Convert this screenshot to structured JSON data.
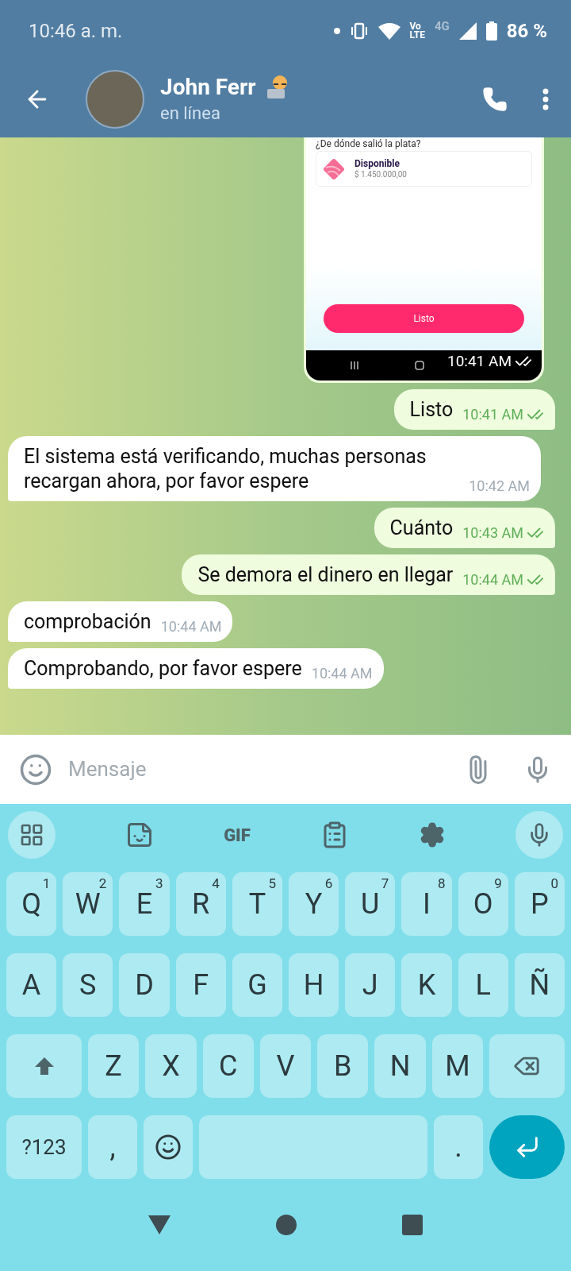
{
  "status_bar": {
    "time": "10:46 a. m.",
    "volte": [
      "Vo",
      "LTE"
    ],
    "network": "4G",
    "battery": "86 %"
  },
  "header": {
    "name": "John Ferr",
    "status": "en línea"
  },
  "messages": [
    {
      "kind": "image",
      "outgoing": true,
      "question": "¿De dónde salió la plata?",
      "item_title": "Disponible",
      "item_amount": "$ 1.450.000,00",
      "button": "Listo",
      "time": "10:41 AM",
      "read": true
    },
    {
      "kind": "text",
      "outgoing": true,
      "text": "Listo",
      "time": "10:41 AM",
      "read": true
    },
    {
      "kind": "text",
      "outgoing": false,
      "text": "El sistema está verificando, muchas personas recargan ahora, por favor espere",
      "time": "10:42 AM"
    },
    {
      "kind": "text",
      "outgoing": true,
      "text": "Cuánto",
      "time": "10:43 AM",
      "read": true
    },
    {
      "kind": "text",
      "outgoing": true,
      "text": "Se demora el dinero en llegar",
      "time": "10:44 AM",
      "read": true
    },
    {
      "kind": "text",
      "outgoing": false,
      "text": "comprobación",
      "time": "10:44 AM"
    },
    {
      "kind": "text",
      "outgoing": false,
      "text": "Comprobando, por favor espere",
      "time": "10:44 AM"
    }
  ],
  "composer": {
    "placeholder": "Mensaje"
  },
  "keyboard": {
    "toolbar_gif": "GIF",
    "rows": [
      [
        {
          "kind": "letter",
          "label": "Q",
          "hint": "1"
        },
        {
          "kind": "letter",
          "label": "W",
          "hint": "2"
        },
        {
          "kind": "letter",
          "label": "E",
          "hint": "3"
        },
        {
          "kind": "letter",
          "label": "R",
          "hint": "4"
        },
        {
          "kind": "letter",
          "label": "T",
          "hint": "5"
        },
        {
          "kind": "letter",
          "label": "Y",
          "hint": "6"
        },
        {
          "kind": "letter",
          "label": "U",
          "hint": "7"
        },
        {
          "kind": "letter",
          "label": "I",
          "hint": "8"
        },
        {
          "kind": "letter",
          "label": "O",
          "hint": "9"
        },
        {
          "kind": "letter",
          "label": "P",
          "hint": "0"
        }
      ],
      [
        {
          "kind": "letter",
          "label": "A"
        },
        {
          "kind": "letter",
          "label": "S"
        },
        {
          "kind": "letter",
          "label": "D"
        },
        {
          "kind": "letter",
          "label": "F"
        },
        {
          "kind": "letter",
          "label": "G"
        },
        {
          "kind": "letter",
          "label": "H"
        },
        {
          "kind": "letter",
          "label": "J"
        },
        {
          "kind": "letter",
          "label": "K"
        },
        {
          "kind": "letter",
          "label": "L"
        },
        {
          "kind": "letter",
          "label": "Ñ"
        }
      ],
      [
        {
          "kind": "shift"
        },
        {
          "kind": "letter",
          "label": "Z"
        },
        {
          "kind": "letter",
          "label": "X"
        },
        {
          "kind": "letter",
          "label": "C"
        },
        {
          "kind": "letter",
          "label": "V"
        },
        {
          "kind": "letter",
          "label": "B"
        },
        {
          "kind": "letter",
          "label": "N"
        },
        {
          "kind": "letter",
          "label": "M"
        },
        {
          "kind": "backspace"
        }
      ],
      [
        {
          "kind": "symbols",
          "label": "?123"
        },
        {
          "kind": "letter",
          "label": ","
        },
        {
          "kind": "emoji"
        },
        {
          "kind": "space"
        },
        {
          "kind": "letter",
          "label": "."
        },
        {
          "kind": "enter"
        }
      ]
    ]
  }
}
